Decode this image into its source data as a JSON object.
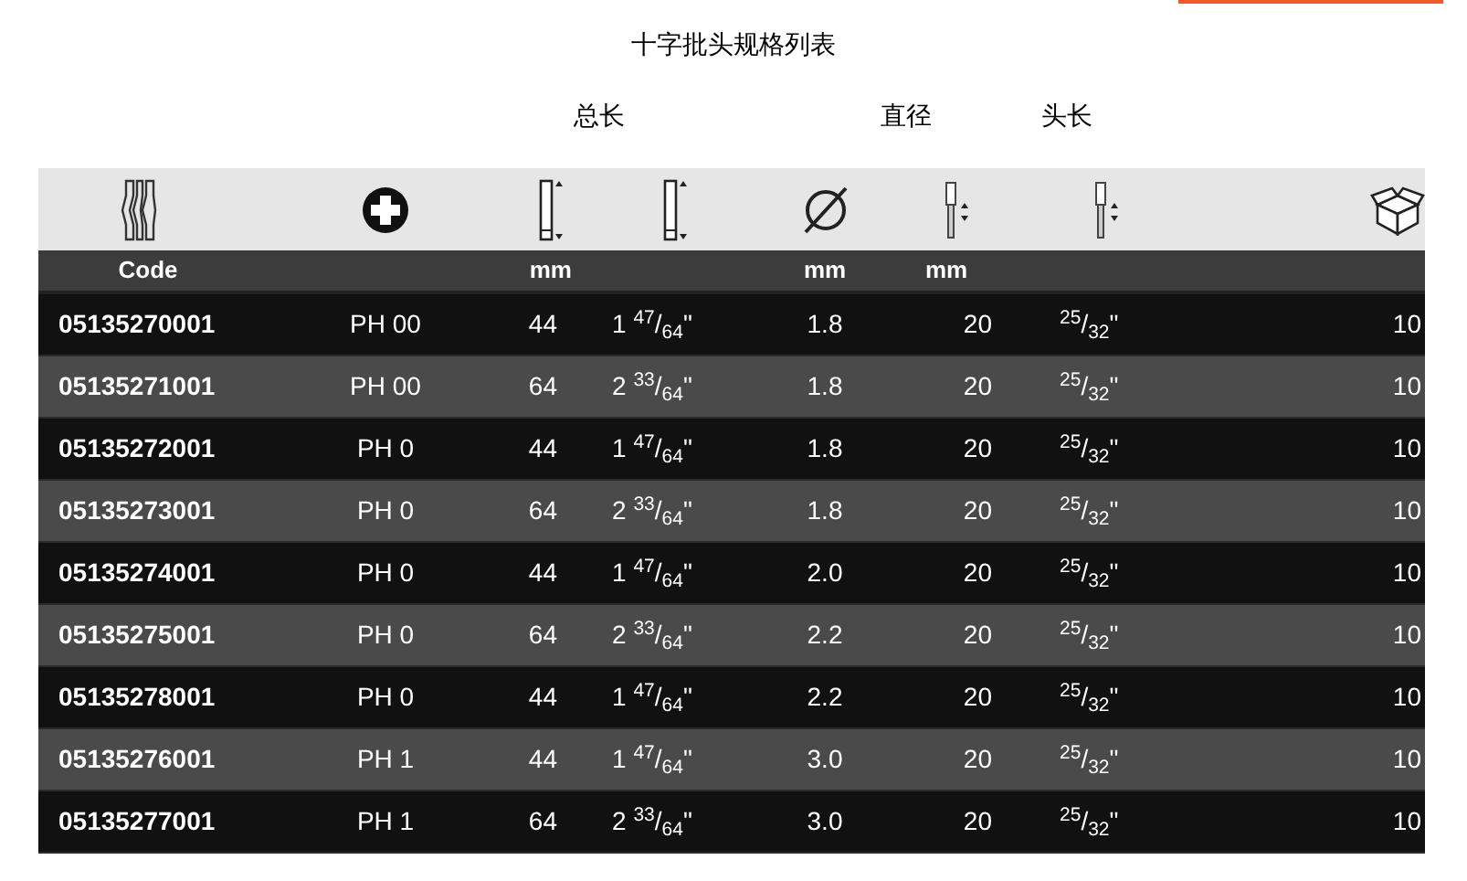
{
  "title": "十字批头规格列表",
  "group_labels": [
    "总长",
    "直径",
    "头长"
  ],
  "columns": [
    {
      "kind": "bits",
      "unit": "Code"
    },
    {
      "kind": "phillips"
    },
    {
      "kind": "length",
      "unit": "mm"
    },
    {
      "kind": "length-alt"
    },
    {
      "kind": "diameter",
      "unit": "mm"
    },
    {
      "kind": "head-length",
      "unit": "mm"
    },
    {
      "kind": "head-length-alt"
    },
    {
      "kind": "box"
    }
  ],
  "rows": [
    [
      "05135270001",
      "PH 00",
      "44",
      "1 $^{47}$/$_{64}$\"",
      "1.8",
      "20",
      "$^{25}$/$_{32}$\"",
      "10"
    ],
    [
      "05135271001",
      "PH 00",
      "64",
      "2 $^{33}$/$_{64}$\"",
      "1.8",
      "20",
      "$^{25}$/$_{32}$\"",
      "10"
    ],
    [
      "05135272001",
      "PH 0",
      "44",
      "1 $^{47}$/$_{64}$\"",
      "1.8",
      "20",
      "$^{25}$/$_{32}$\"",
      "10"
    ],
    [
      "05135273001",
      "PH 0",
      "64",
      "2 $^{33}$/$_{64}$\"",
      "1.8",
      "20",
      "$^{25}$/$_{32}$\"",
      "10"
    ],
    [
      "05135274001",
      "PH 0",
      "44",
      "1 $^{47}$/$_{64}$\"",
      "2.0",
      "20",
      "$^{25}$/$_{32}$\"",
      "10"
    ],
    [
      "05135275001",
      "PH 0",
      "64",
      "2 $^{33}$/$_{64}$\"",
      "2.2",
      "20",
      "$^{25}$/$_{32}$\"",
      "10"
    ],
    [
      "05135278001",
      "PH 0",
      "44",
      "1 $^{47}$/$_{64}$\"",
      "2.2",
      "20",
      "$^{25}$/$_{32}$\"",
      "10"
    ],
    [
      "05135276001",
      "PH 1",
      "44",
      "1 $^{47}$/$_{64}$\"",
      "3.0",
      "20",
      "$^{25}$/$_{32}$\"",
      "10"
    ],
    [
      "05135277001",
      "PH 1",
      "64",
      "2 $^{33}$/$_{64}$\"",
      "3.0",
      "20",
      "$^{25}$/$_{32}$\"",
      "10"
    ]
  ]
}
